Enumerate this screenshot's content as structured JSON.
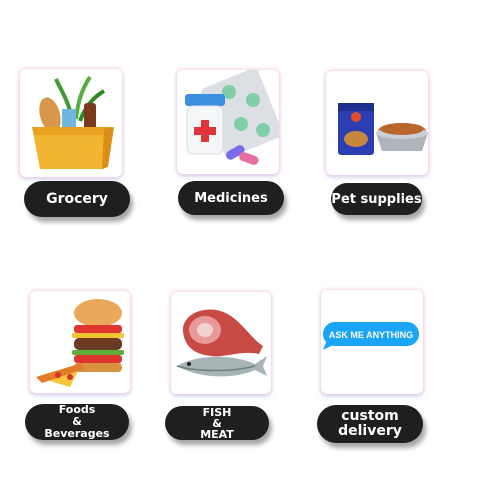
{
  "categories": [
    {
      "id": "grocery",
      "label": "Grocery"
    },
    {
      "id": "medicines",
      "label": "Medicines"
    },
    {
      "id": "pet-supplies",
      "label": "Pet supplies"
    },
    {
      "id": "foods-beverages",
      "label_lines": [
        "Foods",
        "&",
        "Beverages"
      ]
    },
    {
      "id": "fish-meat",
      "label_lines": [
        "FISH",
        "&",
        "MEAT"
      ]
    },
    {
      "id": "custom-delivery",
      "label_lines": [
        "custom",
        "delivery"
      ]
    }
  ],
  "chat_bubble": {
    "text": "ASK ME ANYTHING",
    "color": "#1aa5f5"
  },
  "colors": {
    "pill": "#1f1f21",
    "tile_glow": "#f4a8ce"
  }
}
